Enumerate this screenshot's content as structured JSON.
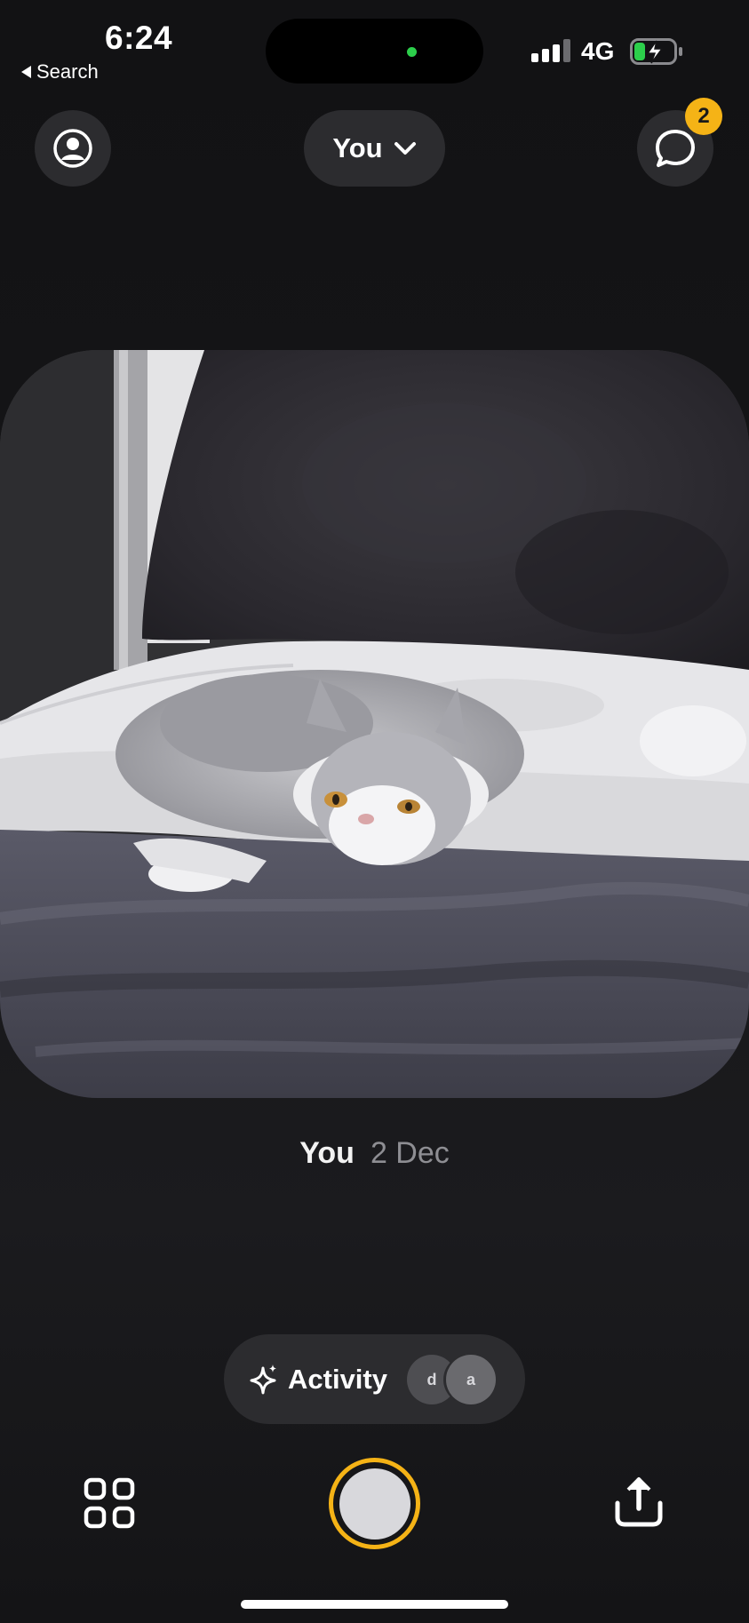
{
  "status_bar": {
    "time": "6:24",
    "back_label": "Search",
    "network": "4G",
    "signal_bars": 3,
    "battery_charging": true
  },
  "header": {
    "feed_selector_label": "You",
    "messages_badge_count": "2"
  },
  "post": {
    "author": "You",
    "date": "2 Dec",
    "image_subject": "cat-on-bed-photo"
  },
  "activity": {
    "label": "Activity",
    "avatars": [
      "d",
      "a"
    ]
  },
  "colors": {
    "accent": "#f5b316",
    "background": "#141416",
    "pill": "#2c2c2f",
    "signal_dot": "#2ccf4b"
  },
  "icons": {
    "profile": "profile-icon",
    "chevron": "chevron-down-icon",
    "chat": "chat-bubble-icon",
    "sparkle": "sparkle-icon",
    "grid": "grid-icon",
    "share": "share-icon"
  }
}
